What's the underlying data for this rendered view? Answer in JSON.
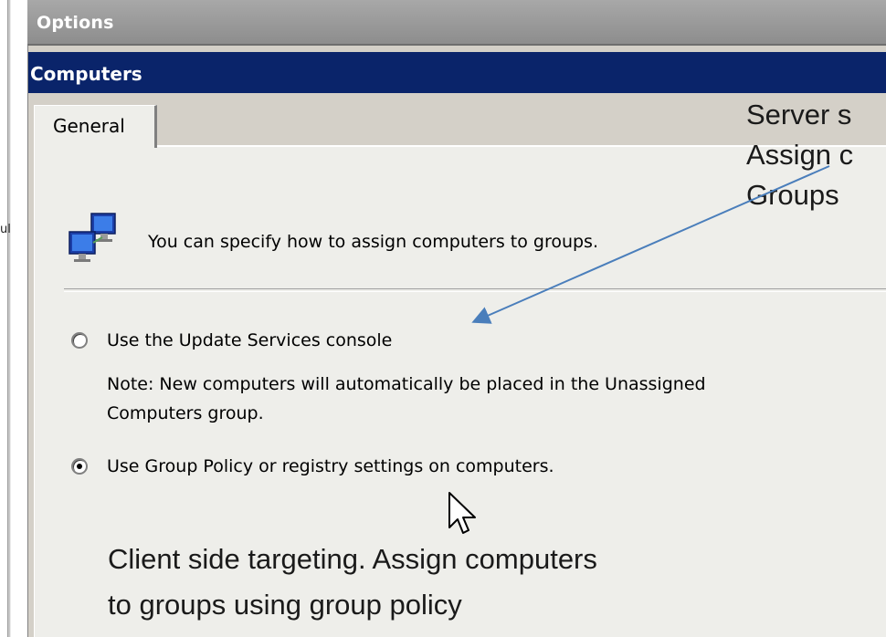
{
  "background_strip": {
    "stray_char": "ul"
  },
  "window": {
    "section_header": "Options",
    "title": "Computers",
    "tabs": [
      {
        "label": "General"
      }
    ]
  },
  "content": {
    "intro_text": "You can specify how to assign computers to groups.",
    "options": [
      {
        "label": "Use the Update Services console",
        "selected": false
      },
      {
        "label": "Use Group Policy or registry settings on computers.",
        "selected": true
      }
    ],
    "note_line1": "Note: New computers will automatically be placed in the Unassigned",
    "note_line2": "Computers group."
  },
  "annotations": {
    "server_side": [
      "Server s",
      "Assign c",
      "Groups"
    ],
    "client_side": [
      "Client side targeting.  Assign computers",
      "to groups using group policy"
    ]
  },
  "colors": {
    "title_bar": "#0a246a",
    "panel": "#eeeeea",
    "arrow": "#4a7ebb"
  }
}
